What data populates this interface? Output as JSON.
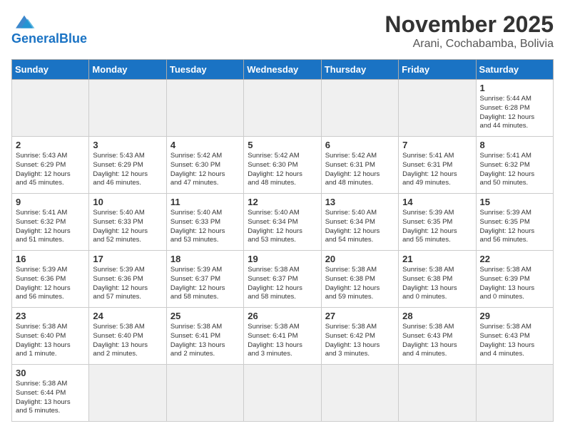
{
  "header": {
    "logo_general": "General",
    "logo_blue": "Blue",
    "month_title": "November 2025",
    "location": "Arani, Cochabamba, Bolivia"
  },
  "weekdays": [
    "Sunday",
    "Monday",
    "Tuesday",
    "Wednesday",
    "Thursday",
    "Friday",
    "Saturday"
  ],
  "rows": [
    [
      {
        "num": "",
        "info": "",
        "empty": true
      },
      {
        "num": "",
        "info": "",
        "empty": true
      },
      {
        "num": "",
        "info": "",
        "empty": true
      },
      {
        "num": "",
        "info": "",
        "empty": true
      },
      {
        "num": "",
        "info": "",
        "empty": true
      },
      {
        "num": "",
        "info": "",
        "empty": true
      },
      {
        "num": "1",
        "info": "Sunrise: 5:44 AM\nSunset: 6:28 PM\nDaylight: 12 hours\nand 44 minutes."
      }
    ],
    [
      {
        "num": "2",
        "info": "Sunrise: 5:43 AM\nSunset: 6:29 PM\nDaylight: 12 hours\nand 45 minutes."
      },
      {
        "num": "3",
        "info": "Sunrise: 5:43 AM\nSunset: 6:29 PM\nDaylight: 12 hours\nand 46 minutes."
      },
      {
        "num": "4",
        "info": "Sunrise: 5:42 AM\nSunset: 6:30 PM\nDaylight: 12 hours\nand 47 minutes."
      },
      {
        "num": "5",
        "info": "Sunrise: 5:42 AM\nSunset: 6:30 PM\nDaylight: 12 hours\nand 48 minutes."
      },
      {
        "num": "6",
        "info": "Sunrise: 5:42 AM\nSunset: 6:31 PM\nDaylight: 12 hours\nand 48 minutes."
      },
      {
        "num": "7",
        "info": "Sunrise: 5:41 AM\nSunset: 6:31 PM\nDaylight: 12 hours\nand 49 minutes."
      },
      {
        "num": "8",
        "info": "Sunrise: 5:41 AM\nSunset: 6:32 PM\nDaylight: 12 hours\nand 50 minutes."
      }
    ],
    [
      {
        "num": "9",
        "info": "Sunrise: 5:41 AM\nSunset: 6:32 PM\nDaylight: 12 hours\nand 51 minutes."
      },
      {
        "num": "10",
        "info": "Sunrise: 5:40 AM\nSunset: 6:33 PM\nDaylight: 12 hours\nand 52 minutes."
      },
      {
        "num": "11",
        "info": "Sunrise: 5:40 AM\nSunset: 6:33 PM\nDaylight: 12 hours\nand 53 minutes."
      },
      {
        "num": "12",
        "info": "Sunrise: 5:40 AM\nSunset: 6:34 PM\nDaylight: 12 hours\nand 53 minutes."
      },
      {
        "num": "13",
        "info": "Sunrise: 5:40 AM\nSunset: 6:34 PM\nDaylight: 12 hours\nand 54 minutes."
      },
      {
        "num": "14",
        "info": "Sunrise: 5:39 AM\nSunset: 6:35 PM\nDaylight: 12 hours\nand 55 minutes."
      },
      {
        "num": "15",
        "info": "Sunrise: 5:39 AM\nSunset: 6:35 PM\nDaylight: 12 hours\nand 56 minutes."
      }
    ],
    [
      {
        "num": "16",
        "info": "Sunrise: 5:39 AM\nSunset: 6:36 PM\nDaylight: 12 hours\nand 56 minutes."
      },
      {
        "num": "17",
        "info": "Sunrise: 5:39 AM\nSunset: 6:36 PM\nDaylight: 12 hours\nand 57 minutes."
      },
      {
        "num": "18",
        "info": "Sunrise: 5:39 AM\nSunset: 6:37 PM\nDaylight: 12 hours\nand 58 minutes."
      },
      {
        "num": "19",
        "info": "Sunrise: 5:38 AM\nSunset: 6:37 PM\nDaylight: 12 hours\nand 58 minutes."
      },
      {
        "num": "20",
        "info": "Sunrise: 5:38 AM\nSunset: 6:38 PM\nDaylight: 12 hours\nand 59 minutes."
      },
      {
        "num": "21",
        "info": "Sunrise: 5:38 AM\nSunset: 6:38 PM\nDaylight: 13 hours\nand 0 minutes."
      },
      {
        "num": "22",
        "info": "Sunrise: 5:38 AM\nSunset: 6:39 PM\nDaylight: 13 hours\nand 0 minutes."
      }
    ],
    [
      {
        "num": "23",
        "info": "Sunrise: 5:38 AM\nSunset: 6:40 PM\nDaylight: 13 hours\nand 1 minute."
      },
      {
        "num": "24",
        "info": "Sunrise: 5:38 AM\nSunset: 6:40 PM\nDaylight: 13 hours\nand 2 minutes."
      },
      {
        "num": "25",
        "info": "Sunrise: 5:38 AM\nSunset: 6:41 PM\nDaylight: 13 hours\nand 2 minutes."
      },
      {
        "num": "26",
        "info": "Sunrise: 5:38 AM\nSunset: 6:41 PM\nDaylight: 13 hours\nand 3 minutes."
      },
      {
        "num": "27",
        "info": "Sunrise: 5:38 AM\nSunset: 6:42 PM\nDaylight: 13 hours\nand 3 minutes."
      },
      {
        "num": "28",
        "info": "Sunrise: 5:38 AM\nSunset: 6:43 PM\nDaylight: 13 hours\nand 4 minutes."
      },
      {
        "num": "29",
        "info": "Sunrise: 5:38 AM\nSunset: 6:43 PM\nDaylight: 13 hours\nand 4 minutes."
      }
    ],
    [
      {
        "num": "30",
        "info": "Sunrise: 5:38 AM\nSunset: 6:44 PM\nDaylight: 13 hours\nand 5 minutes."
      },
      {
        "num": "",
        "info": "",
        "empty": true
      },
      {
        "num": "",
        "info": "",
        "empty": true
      },
      {
        "num": "",
        "info": "",
        "empty": true
      },
      {
        "num": "",
        "info": "",
        "empty": true
      },
      {
        "num": "",
        "info": "",
        "empty": true
      },
      {
        "num": "",
        "info": "",
        "empty": true
      }
    ]
  ]
}
